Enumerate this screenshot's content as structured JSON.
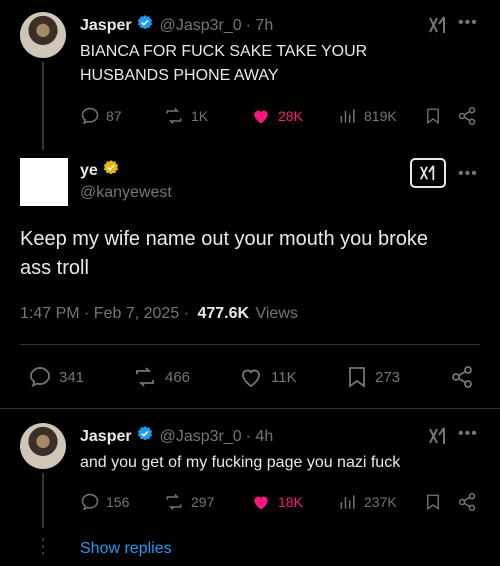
{
  "reply1": {
    "name": "Jasper",
    "handle": "@Jasp3r_0",
    "time": "· 7h",
    "text_line1": "BIANCA FOR FUCK SAKE TAKE YOUR",
    "text_line2": "HUSBANDS PHONE AWAY",
    "replies": "87",
    "reposts": "1K",
    "likes": "28K",
    "views": "819K"
  },
  "main": {
    "name": "ye",
    "handle": "@kanyewest",
    "text_line1": "Keep my wife name out your mouth you broke",
    "text_line2": "ass troll",
    "time": "1:47 PM · Feb 7, 2025 ·",
    "views_count": "477.6K",
    "views_label": "Views",
    "replies": "341",
    "reposts": "466",
    "likes": "11K",
    "bookmarks": "273"
  },
  "reply2": {
    "name": "Jasper",
    "handle": "@Jasp3r_0",
    "time": "· 4h",
    "text": "and you get of my fucking page you nazi fuck",
    "replies": "156",
    "reposts": "297",
    "likes": "18K",
    "views": "237K"
  },
  "show_replies": "Show replies",
  "icons": {
    "verified_blue": "verified-blue-badge",
    "verified_gold": "verified-gold-badge",
    "grok": "grok-icon"
  },
  "colors": {
    "background": "#000000",
    "text": "#e7e9ea",
    "muted": "#71767b",
    "like": "#f91880",
    "link": "#1d9bf0",
    "verified_blue": "#1d9bf0",
    "verified_gold": "#e2b719"
  }
}
